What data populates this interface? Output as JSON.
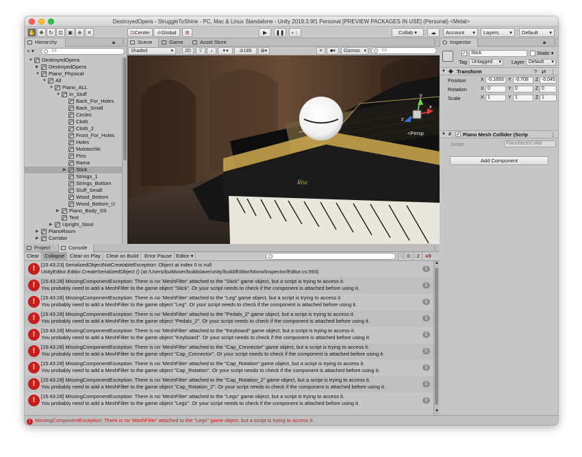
{
  "window": {
    "title": "DestroyedOpera - StruggleToShine - PC, Mac & Linux Standalone - Unity 2019.3.9f1 Personal [PREVIEW PACKAGES IN USE] (Personal) <Metal>"
  },
  "toolbar": {
    "center_label": "Center",
    "global_label": "Global",
    "collab_label": "Collab ▾",
    "account_label": "Account",
    "layers_label": "Layers",
    "layout_label": "Default"
  },
  "hierarchy": {
    "tab_label": "Hierarchy",
    "add_label": "+ ▾",
    "search_placeholder": "All",
    "items": [
      {
        "label": "DestroyedOpera",
        "depth": 0,
        "arrow": "▼",
        "selected": false
      },
      {
        "label": "DestroyedOpera",
        "depth": 1,
        "arrow": "▶",
        "selected": false
      },
      {
        "label": "Piano_Physical",
        "depth": 1,
        "arrow": "▼",
        "selected": false
      },
      {
        "label": "All",
        "depth": 2,
        "arrow": "▼",
        "selected": false
      },
      {
        "label": "Piano_ALL",
        "depth": 3,
        "arrow": "▼",
        "selected": false
      },
      {
        "label": "In_Stuff",
        "depth": 4,
        "arrow": "▼",
        "selected": false
      },
      {
        "label": "Back_For_Holes",
        "depth": 5,
        "arrow": "",
        "selected": false
      },
      {
        "label": "Back_Small",
        "depth": 5,
        "arrow": "",
        "selected": false
      },
      {
        "label": "Circles",
        "depth": 5,
        "arrow": "",
        "selected": false
      },
      {
        "label": "Cloth",
        "depth": 5,
        "arrow": "",
        "selected": false
      },
      {
        "label": "Cloth_2",
        "depth": 5,
        "arrow": "",
        "selected": false
      },
      {
        "label": "Front_For_Holes",
        "depth": 5,
        "arrow": "",
        "selected": false
      },
      {
        "label": "Holes",
        "depth": 5,
        "arrow": "",
        "selected": false
      },
      {
        "label": "Molotochki",
        "depth": 5,
        "arrow": "",
        "selected": false
      },
      {
        "label": "Pins",
        "depth": 5,
        "arrow": "",
        "selected": false
      },
      {
        "label": "Rama",
        "depth": 5,
        "arrow": "",
        "selected": false
      },
      {
        "label": "Stick",
        "depth": 5,
        "arrow": "▶",
        "selected": true
      },
      {
        "label": "Strings_1",
        "depth": 5,
        "arrow": "",
        "selected": false
      },
      {
        "label": "Strings_Bottom",
        "depth": 5,
        "arrow": "",
        "selected": false
      },
      {
        "label": "Stuff_Small",
        "depth": 5,
        "arrow": "",
        "selected": false
      },
      {
        "label": "Wood_Bottom",
        "depth": 5,
        "arrow": "",
        "selected": false
      },
      {
        "label": "Wood_Bottom_U",
        "depth": 5,
        "arrow": "",
        "selected": false
      },
      {
        "label": "Piano_Body_SS",
        "depth": 4,
        "arrow": "▶",
        "selected": false
      },
      {
        "label": "Text",
        "depth": 4,
        "arrow": "",
        "selected": false
      },
      {
        "label": "Upright_Stool",
        "depth": 3,
        "arrow": "▶",
        "selected": false
      },
      {
        "label": "PianoRoom",
        "depth": 1,
        "arrow": "▶",
        "selected": false
      },
      {
        "label": "Corridor",
        "depth": 1,
        "arrow": "▶",
        "selected": false
      }
    ]
  },
  "scene": {
    "tabs": [
      "Scene",
      "Game",
      "Asset Store"
    ],
    "shading": "Shaded",
    "mode_2d": "2D",
    "hidden_count": "189",
    "gizmos_label": "Gizmos",
    "search_placeholder": "All",
    "persp_label": "<Persp",
    "piano_brand": "Rise"
  },
  "inspector": {
    "tab_label": "Inspector",
    "object_name": "Stick",
    "static_label": "Static ▾",
    "tag_label": "Tag",
    "tag_value": "Untagged",
    "layer_label": "Layer",
    "layer_value": "Default",
    "transform": {
      "title": "Transform",
      "position_label": "Position",
      "rotation_label": "Rotation",
      "scale_label": "Scale",
      "position": [
        "-0.1693",
        "-0.708",
        "-0.045"
      ],
      "rotation": [
        "0",
        "0",
        "0"
      ],
      "scale": [
        "1",
        "1",
        "1"
      ]
    },
    "collider": {
      "title": "Piano Mesh Collider (Scrip",
      "script_label": "Script",
      "script_value": "PianoMeshCollid"
    },
    "add_component_label": "Add Component"
  },
  "console": {
    "tabs": [
      "Project",
      "Console"
    ],
    "buttons": [
      "Clear",
      "Collapse",
      "Clear on Play",
      "Clear on Build",
      "Error Pause",
      "Editor ▾"
    ],
    "counts": {
      "log": "0",
      "warn": "2",
      "error": "9"
    },
    "entries": [
      {
        "line1": "[15:43:23] SerializedObjectNotCreatableException: Object at index 0 is null",
        "line2": "UnityEditor.Editor.CreateSerializedObject () (at /Users/builduser/buildslave/unity/build/Editor/Mono/Inspector/Editor.cs:593)",
        "count": "1"
      },
      {
        "line1": "[15:43:28] MissingComponentException: There is no 'MeshFilter' attached to the \"Stick\" game object, but a script is trying to access it.",
        "line2": "You probably need to add a MeshFilter to the game object \"Stick\". Or your script needs to check if the component is attached before using it.",
        "count": "1"
      },
      {
        "line1": "[15:43:28] MissingComponentException: There is no 'MeshFilter' attached to the \"Leg\" game object, but a script is trying to access it.",
        "line2": "You probably need to add a MeshFilter to the game object \"Leg\". Or your script needs to check if the component is attached before using it.",
        "count": "1"
      },
      {
        "line1": "[15:43:28] MissingComponentException: There is no 'MeshFilter' attached to the \"Pedals_2\" game object, but a script is trying to access it.",
        "line2": "You probably need to add a MeshFilter to the game object \"Pedals_2\". Or your script needs to check if the component is attached before using it.",
        "count": "1"
      },
      {
        "line1": "[15:43:28] MissingComponentException: There is no 'MeshFilter' attached to the \"Keyboard\" game object, but a script is trying to access it.",
        "line2": "You probably need to add a MeshFilter to the game object \"Keyboard\". Or your script needs to check if the component is attached before using it.",
        "count": "1"
      },
      {
        "line1": "[15:43:28] MissingComponentException: There is no 'MeshFilter' attached to the \"Cap_Connector\" game object, but a script is trying to access it.",
        "line2": "You probably need to add a MeshFilter to the game object \"Cap_Connector\". Or your script needs to check if the component is attached before using it.",
        "count": "1"
      },
      {
        "line1": "[15:43:28] MissingComponentException: There is no 'MeshFilter' attached to the \"Cap_Rotation\" game object, but a script is trying to access it.",
        "line2": "You probably need to add a MeshFilter to the game object \"Cap_Rotation\". Or your script needs to check if the component is attached before using it.",
        "count": "1"
      },
      {
        "line1": "[15:43:28] MissingComponentException: There is no 'MeshFilter' attached to the \"Cap_Rotation_2\" game object, but a script is trying to access it.",
        "line2": "You probably need to add a MeshFilter to the game object \"Cap_Rotation_2\". Or your script needs to check if the component is attached before using it.",
        "count": "1"
      },
      {
        "line1": "[15:43:28] MissingComponentException: There is no 'MeshFilter' attached to the \"Legs\" game object, but a script is trying to access it.",
        "line2": "You probably need to add a MeshFilter to the game object \"Legs\". Or your script needs to check if the component is attached before using it.",
        "count": "1"
      }
    ]
  },
  "status_bar": {
    "message": "MissingComponentException: There is no 'MeshFilter' attached to the \"Legs\" game object, but a script is trying to access it."
  },
  "colors": {
    "error_red": "#c81d1d",
    "selection": "#a9a9a9",
    "panel_bg": "#c6c6c6"
  }
}
